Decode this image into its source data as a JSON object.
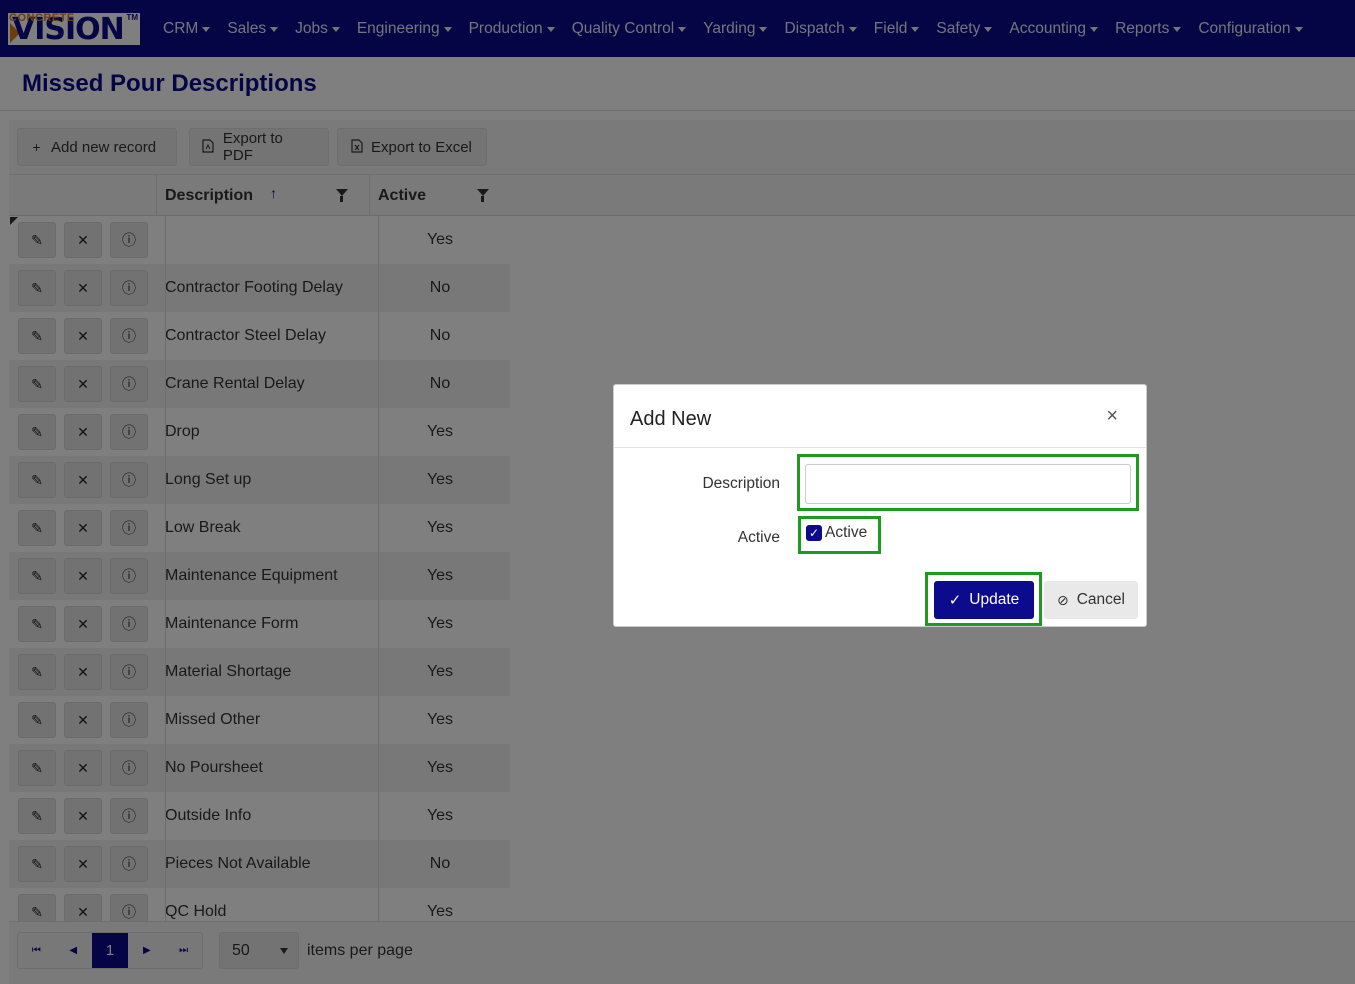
{
  "nav": {
    "logo_small": "CONCRETE",
    "logo_big": "VISION",
    "logo_tm": "TM",
    "items": [
      "CRM",
      "Sales",
      "Jobs",
      "Engineering",
      "Production",
      "Quality Control",
      "Yarding",
      "Dispatch",
      "Field",
      "Safety",
      "Accounting",
      "Reports",
      "Configuration"
    ]
  },
  "page": {
    "title": "Missed Pour Descriptions"
  },
  "toolbar": {
    "add_label": "Add new record",
    "pdf_label": "Export to PDF",
    "excel_label": "Export to Excel"
  },
  "grid": {
    "columns": {
      "description": "Description",
      "active": "Active"
    },
    "rows": [
      {
        "description": "",
        "active": "Yes"
      },
      {
        "description": "Contractor Footing Delay",
        "active": "No"
      },
      {
        "description": "Contractor Steel Delay",
        "active": "No"
      },
      {
        "description": "Crane Rental Delay",
        "active": "No"
      },
      {
        "description": "Drop",
        "active": "Yes"
      },
      {
        "description": "Long Set up",
        "active": "Yes"
      },
      {
        "description": "Low Break",
        "active": "Yes"
      },
      {
        "description": "Maintenance Equipment",
        "active": "Yes"
      },
      {
        "description": "Maintenance Form",
        "active": "Yes"
      },
      {
        "description": "Material Shortage",
        "active": "Yes"
      },
      {
        "description": "Missed Other",
        "active": "Yes"
      },
      {
        "description": "No Poursheet",
        "active": "Yes"
      },
      {
        "description": "Outside Info",
        "active": "Yes"
      },
      {
        "description": "Pieces Not Available",
        "active": "No"
      },
      {
        "description": "QC Hold",
        "active": "Yes"
      }
    ]
  },
  "pager": {
    "current_page": "1",
    "page_size": "50",
    "items_per_page_label": "items per page"
  },
  "dialog": {
    "title": "Add New",
    "close": "×",
    "description_label": "Description",
    "description_value": "",
    "active_label": "Active",
    "active_checkbox_label": "Active",
    "active_checked": true,
    "update_label": "Update",
    "cancel_label": "Cancel"
  },
  "colors": {
    "brand": "#0b0b8c",
    "highlight": "#1e9b1e",
    "accent": "#d97a1a"
  }
}
